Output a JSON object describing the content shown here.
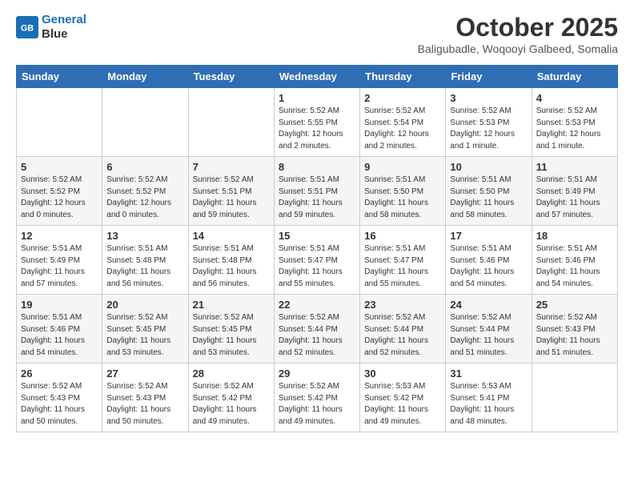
{
  "header": {
    "logo_line1": "General",
    "logo_line2": "Blue",
    "month": "October 2025",
    "location": "Baligubadle, Woqooyi Galbeed, Somalia"
  },
  "days_of_week": [
    "Sunday",
    "Monday",
    "Tuesday",
    "Wednesday",
    "Thursday",
    "Friday",
    "Saturday"
  ],
  "weeks": [
    [
      {
        "day": "",
        "info": ""
      },
      {
        "day": "",
        "info": ""
      },
      {
        "day": "",
        "info": ""
      },
      {
        "day": "1",
        "info": "Sunrise: 5:52 AM\nSunset: 5:55 PM\nDaylight: 12 hours\nand 2 minutes."
      },
      {
        "day": "2",
        "info": "Sunrise: 5:52 AM\nSunset: 5:54 PM\nDaylight: 12 hours\nand 2 minutes."
      },
      {
        "day": "3",
        "info": "Sunrise: 5:52 AM\nSunset: 5:53 PM\nDaylight: 12 hours\nand 1 minute."
      },
      {
        "day": "4",
        "info": "Sunrise: 5:52 AM\nSunset: 5:53 PM\nDaylight: 12 hours\nand 1 minute."
      }
    ],
    [
      {
        "day": "5",
        "info": "Sunrise: 5:52 AM\nSunset: 5:52 PM\nDaylight: 12 hours\nand 0 minutes."
      },
      {
        "day": "6",
        "info": "Sunrise: 5:52 AM\nSunset: 5:52 PM\nDaylight: 12 hours\nand 0 minutes."
      },
      {
        "day": "7",
        "info": "Sunrise: 5:52 AM\nSunset: 5:51 PM\nDaylight: 11 hours\nand 59 minutes."
      },
      {
        "day": "8",
        "info": "Sunrise: 5:51 AM\nSunset: 5:51 PM\nDaylight: 11 hours\nand 59 minutes."
      },
      {
        "day": "9",
        "info": "Sunrise: 5:51 AM\nSunset: 5:50 PM\nDaylight: 11 hours\nand 58 minutes."
      },
      {
        "day": "10",
        "info": "Sunrise: 5:51 AM\nSunset: 5:50 PM\nDaylight: 11 hours\nand 58 minutes."
      },
      {
        "day": "11",
        "info": "Sunrise: 5:51 AM\nSunset: 5:49 PM\nDaylight: 11 hours\nand 57 minutes."
      }
    ],
    [
      {
        "day": "12",
        "info": "Sunrise: 5:51 AM\nSunset: 5:49 PM\nDaylight: 11 hours\nand 57 minutes."
      },
      {
        "day": "13",
        "info": "Sunrise: 5:51 AM\nSunset: 5:48 PM\nDaylight: 11 hours\nand 56 minutes."
      },
      {
        "day": "14",
        "info": "Sunrise: 5:51 AM\nSunset: 5:48 PM\nDaylight: 11 hours\nand 56 minutes."
      },
      {
        "day": "15",
        "info": "Sunrise: 5:51 AM\nSunset: 5:47 PM\nDaylight: 11 hours\nand 55 minutes."
      },
      {
        "day": "16",
        "info": "Sunrise: 5:51 AM\nSunset: 5:47 PM\nDaylight: 11 hours\nand 55 minutes."
      },
      {
        "day": "17",
        "info": "Sunrise: 5:51 AM\nSunset: 5:46 PM\nDaylight: 11 hours\nand 54 minutes."
      },
      {
        "day": "18",
        "info": "Sunrise: 5:51 AM\nSunset: 5:46 PM\nDaylight: 11 hours\nand 54 minutes."
      }
    ],
    [
      {
        "day": "19",
        "info": "Sunrise: 5:51 AM\nSunset: 5:46 PM\nDaylight: 11 hours\nand 54 minutes."
      },
      {
        "day": "20",
        "info": "Sunrise: 5:52 AM\nSunset: 5:45 PM\nDaylight: 11 hours\nand 53 minutes."
      },
      {
        "day": "21",
        "info": "Sunrise: 5:52 AM\nSunset: 5:45 PM\nDaylight: 11 hours\nand 53 minutes."
      },
      {
        "day": "22",
        "info": "Sunrise: 5:52 AM\nSunset: 5:44 PM\nDaylight: 11 hours\nand 52 minutes."
      },
      {
        "day": "23",
        "info": "Sunrise: 5:52 AM\nSunset: 5:44 PM\nDaylight: 11 hours\nand 52 minutes."
      },
      {
        "day": "24",
        "info": "Sunrise: 5:52 AM\nSunset: 5:44 PM\nDaylight: 11 hours\nand 51 minutes."
      },
      {
        "day": "25",
        "info": "Sunrise: 5:52 AM\nSunset: 5:43 PM\nDaylight: 11 hours\nand 51 minutes."
      }
    ],
    [
      {
        "day": "26",
        "info": "Sunrise: 5:52 AM\nSunset: 5:43 PM\nDaylight: 11 hours\nand 50 minutes."
      },
      {
        "day": "27",
        "info": "Sunrise: 5:52 AM\nSunset: 5:43 PM\nDaylight: 11 hours\nand 50 minutes."
      },
      {
        "day": "28",
        "info": "Sunrise: 5:52 AM\nSunset: 5:42 PM\nDaylight: 11 hours\nand 49 minutes."
      },
      {
        "day": "29",
        "info": "Sunrise: 5:52 AM\nSunset: 5:42 PM\nDaylight: 11 hours\nand 49 minutes."
      },
      {
        "day": "30",
        "info": "Sunrise: 5:53 AM\nSunset: 5:42 PM\nDaylight: 11 hours\nand 49 minutes."
      },
      {
        "day": "31",
        "info": "Sunrise: 5:53 AM\nSunset: 5:41 PM\nDaylight: 11 hours\nand 48 minutes."
      },
      {
        "day": "",
        "info": ""
      }
    ]
  ]
}
